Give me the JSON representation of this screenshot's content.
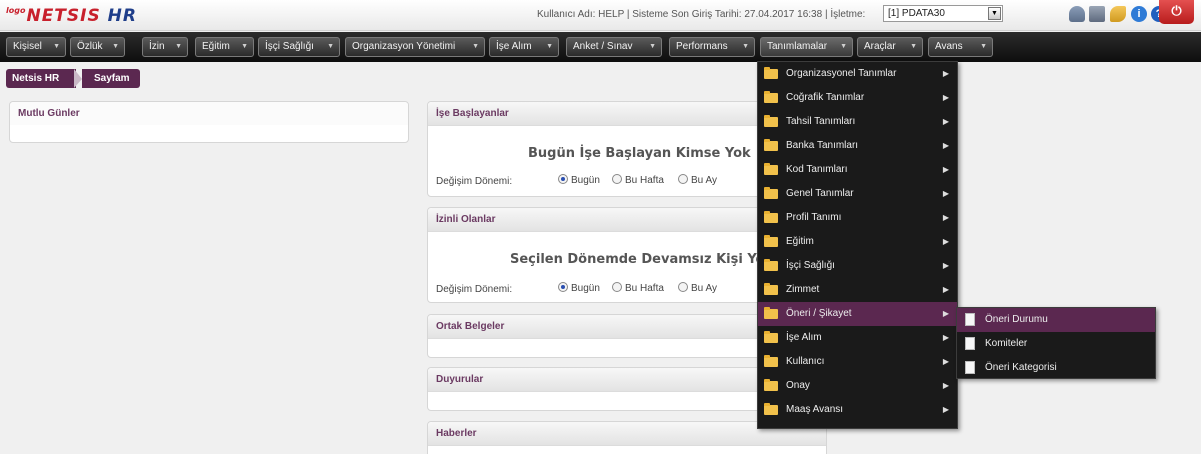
{
  "header": {
    "logo_prefix": "logo",
    "logo_main": "NETSIS",
    "logo_suffix": "HR",
    "user_info": "Kullanıcı Adı: HELP | Sisteme Son Giriş Tarihi: 27.04.2017 16:38 | İşletme:",
    "company_value": "[1] PDATA30",
    "icons": [
      "users-icon",
      "message-icon",
      "key-icon",
      "info-icon",
      "help-icon"
    ],
    "power_icon": "power-icon"
  },
  "nav": {
    "items": [
      "Kişisel",
      "Özlük",
      "İzin",
      "Eğitim",
      "İşçi Sağlığı",
      "Organizasyon Yönetimi",
      "İşe Alım",
      "Anket / Sınav",
      "Performans",
      "Tanımlamalar",
      "Araçlar",
      "Avans"
    ]
  },
  "breadcrumb": {
    "root": "Netsis HR",
    "current": "Sayfam"
  },
  "panels": {
    "birthdays": {
      "title": "Mutlu Günler"
    },
    "starters": {
      "title": "İşe Başlayanlar",
      "message": "Bugün İşe Başlayan Kimse Yok",
      "period_label": "Değişim Dönemi:",
      "options": [
        "Bugün",
        "Bu Hafta",
        "Bu Ay"
      ],
      "selected": "Bugün"
    },
    "on_leave": {
      "title": "İzinli Olanlar",
      "message": "Seçilen Dönemde Devamsız Kişi Yok",
      "period_label": "Değişim Dönemi:",
      "options": [
        "Bugün",
        "Bu Hafta",
        "Bu Ay"
      ],
      "selected": "Bugün"
    },
    "shared_docs": {
      "title": "Ortak Belgeler"
    },
    "announcements": {
      "title": "Duyurular"
    },
    "news": {
      "title": "Haberler"
    }
  },
  "dropdown": {
    "items": [
      "Organizasyonel Tanımlar",
      "Coğrafik Tanımlar",
      "Tahsil Tanımları",
      "Banka Tanımları",
      "Kod Tanımları",
      "Genel Tanımlar",
      "Profil Tanımı",
      "Eğitim",
      "İşçi Sağlığı",
      "Zimmet",
      "Öneri / Şikayet",
      "İşe Alım",
      "Kullanıcı",
      "Onay",
      "Maaş Avansı"
    ],
    "highlighted": "Öneri / Şikayet",
    "submenu": [
      "Öneri Durumu",
      "Komiteler",
      "Öneri Kategorisi"
    ],
    "submenu_highlighted": "Öneri Durumu"
  },
  "colors": {
    "accent": "#5b2850",
    "brand_red": "#c8202c",
    "brand_blue": "#1f3e8a"
  }
}
